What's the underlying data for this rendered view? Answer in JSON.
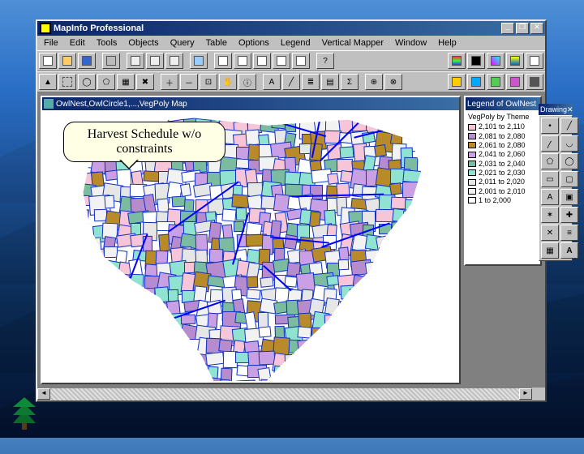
{
  "app": {
    "title": "MapInfo Professional",
    "menus": [
      "File",
      "Edit",
      "Tools",
      "Objects",
      "Query",
      "Table",
      "Options",
      "Legend",
      "Vertical Mapper",
      "Window",
      "Help"
    ],
    "win_buttons": {
      "min": "_",
      "max": "❐",
      "close": "✕"
    }
  },
  "callout": {
    "line1": "Harvest Schedule w/o",
    "line2": "constraints"
  },
  "map_window": {
    "title": "OwlNest,OwlCircle1,...,VegPoly Map"
  },
  "legend_window": {
    "title": "Legend of OwlNest",
    "group_title": "VegPoly by Theme",
    "items": [
      {
        "label": "2,101 to 2,110",
        "color": "#f6c5d8"
      },
      {
        "label": "2,081 to 2,080",
        "color": "#b68ccf"
      },
      {
        "label": "2,061 to 2,080",
        "color": "#b88a2a"
      },
      {
        "label": "2,041 to 2,060",
        "color": "#caa0e5"
      },
      {
        "label": "2,031 to 2,040",
        "color": "#7abba2"
      },
      {
        "label": "2,021 to 2,030",
        "color": "#8fe3d0"
      },
      {
        "label": "2,011 to 2,020",
        "color": "#e6e6e6"
      },
      {
        "label": "2,001 to 2,010",
        "color": "#f2f2f2"
      },
      {
        "label": "1 to 2,000",
        "color": "#ffffff"
      }
    ]
  },
  "drawing_bar": {
    "title": "Drawing",
    "close": "✕"
  },
  "scrollbar": {
    "left": "◄",
    "right": "►"
  },
  "colors": {
    "titlebar_start": "#0a246a",
    "titlebar_end": "#3a6ea5",
    "face": "#c0c0c0",
    "polygon_outline": "#1030c0",
    "stream": "#0000ff"
  }
}
